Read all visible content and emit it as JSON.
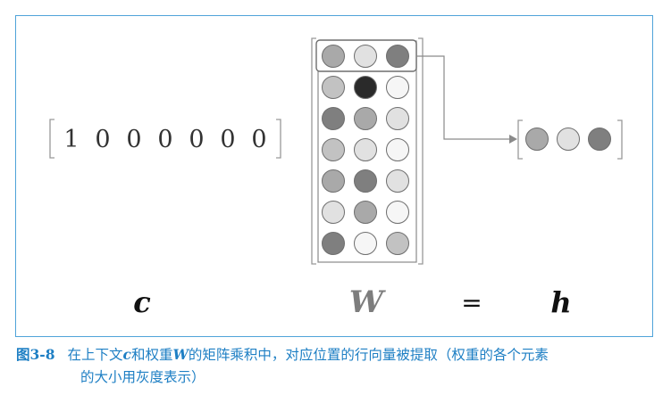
{
  "vector_c": {
    "values": [
      "1",
      "0",
      "0",
      "0",
      "0",
      "0",
      "0"
    ]
  },
  "matrix_W": {
    "rows": [
      [
        "#a9a9a9",
        "#e1e1e1",
        "#7f7f7f"
      ],
      [
        "#c2c2c2",
        "#2a2a2a",
        "#f6f6f6"
      ],
      [
        "#7f7f7f",
        "#a9a9a9",
        "#e1e1e1"
      ],
      [
        "#c2c2c2",
        "#e1e1e1",
        "#f6f6f6"
      ],
      [
        "#a9a9a9",
        "#7f7f7f",
        "#e1e1e1"
      ],
      [
        "#e1e1e1",
        "#a9a9a9",
        "#f6f6f6"
      ],
      [
        "#7f7f7f",
        "#f6f6f6",
        "#c2c2c2"
      ]
    ],
    "highlighted_row": 0
  },
  "vector_h": {
    "circles": [
      "#a9a9a9",
      "#e1e1e1",
      "#7f7f7f"
    ]
  },
  "labels": {
    "c": "c",
    "W": "W",
    "equals": "=",
    "h": "h"
  },
  "caption": {
    "figure_label": "图3-8",
    "part1": "在上下文",
    "var_c": "c",
    "part2": "和权重",
    "var_W": "W",
    "part3": "的矩阵乘积中，对应位置的行向量被提取（权重的各个元素",
    "line2": "的大小用灰度表示）"
  },
  "colors": {
    "frame_border": "#4fa3d9",
    "caption_text": "#1e7fc4",
    "bracket": "#999999",
    "circle_stroke": "#6e6e6e",
    "arrow": "#8a8a8a"
  }
}
